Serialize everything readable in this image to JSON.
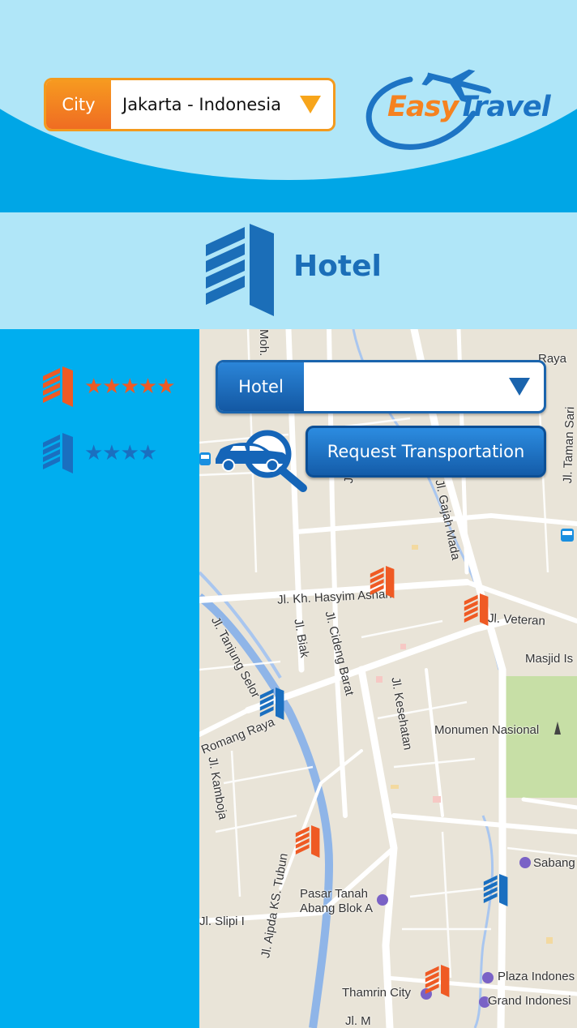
{
  "header": {
    "city_label": "City",
    "city_value": "Jakarta - Indonesia",
    "logo_easy": "Easy",
    "logo_travel": "Travel"
  },
  "section": {
    "title": "Hotel"
  },
  "ratings": [
    {
      "stars": "★★★★★",
      "color": "#ef5a24"
    },
    {
      "stars": "★★★★",
      "color": "#1a6fc0"
    }
  ],
  "map": {
    "hotel_select_label": "Hotel",
    "hotel_select_value": "",
    "transport_button": "Request Transportation",
    "labels": {
      "moh": "Moh.",
      "raya": "Raya",
      "jl_tan": "Jl. Tan",
      "jl_gajah_mada": "Jl. Gajah Mada",
      "jl_taman_sari": "Jl. Taman Sari",
      "jl_kh_hasyim": "Jl. Kh. Hasyim Ashari",
      "jl_veteran": "Jl. Veteran",
      "masjid": "Masjid Is",
      "jl_tanjung_selor": "Jl. Tanjung Selor",
      "jl_biak": "Jl. Biak",
      "jl_cideng_barat": "Jl. Cideng Barat",
      "jl_kesehatan": "Jl. Kesehatan",
      "monumen": "Monumen Nasional",
      "romang_raya": "Romang Raya",
      "jl_kamboja": "Jl. Kamboja",
      "sabang": "Sabang",
      "pasar_tanah_abang_1": "Pasar Tanah",
      "pasar_tanah_abang_2": "Abang Blok A",
      "jl_slipi": "Jl. Slipi I",
      "jl_ks_tubun": "Jl. Aipda KS. Tubun",
      "plaza_indonesia": "Plaza Indones",
      "thamrin_city": "Thamrin City",
      "grand_indonesia": "Grand Indonesi",
      "jl_mm": "Jl. M"
    }
  },
  "colors": {
    "sky_light": "#b0e6f8",
    "sky_blue": "#00aeef",
    "brand_blue": "#1b6eb8",
    "brand_orange": "#f58220",
    "pin_orange": "#ef5a24",
    "pin_blue": "#1a6fc0"
  },
  "icons": [
    "chevron-down-icon",
    "plane-icon",
    "hotel-building-icon",
    "car-search-icon",
    "bus-icon"
  ]
}
